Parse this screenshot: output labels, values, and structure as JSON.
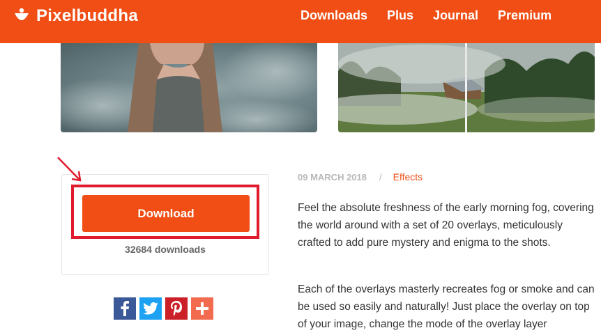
{
  "header": {
    "brand": "Pixelbuddha",
    "nav": [
      "Downloads",
      "Plus",
      "Journal",
      "Premium"
    ]
  },
  "download": {
    "button_label": "Download",
    "count_text": "32684 downloads"
  },
  "share": {
    "buttons": [
      {
        "name": "facebook",
        "glyph": "f",
        "color": "#3b5998"
      },
      {
        "name": "twitter",
        "glyph": "t",
        "color": "#1da1f2"
      },
      {
        "name": "pinterest",
        "glyph": "p",
        "color": "#cb2027"
      },
      {
        "name": "more",
        "glyph": "+",
        "color": "#f26b4e"
      }
    ]
  },
  "post": {
    "date": "09 MARCH 2018",
    "separator": "/",
    "category": "Effects",
    "paragraphs": [
      "Feel the absolute freshness of the early morning fog, covering the world around with a set of 20 overlays, meticulously crafted to add pure mystery and enigma to the shots.",
      "Each of the overlays masterly recreates fog or smoke and can be used so easily and naturally! Just place the overlay on top of your image, change the mode of the overlay layer"
    ]
  },
  "colors": {
    "brand": "#f04e14",
    "annotation": "#e01b2d"
  }
}
